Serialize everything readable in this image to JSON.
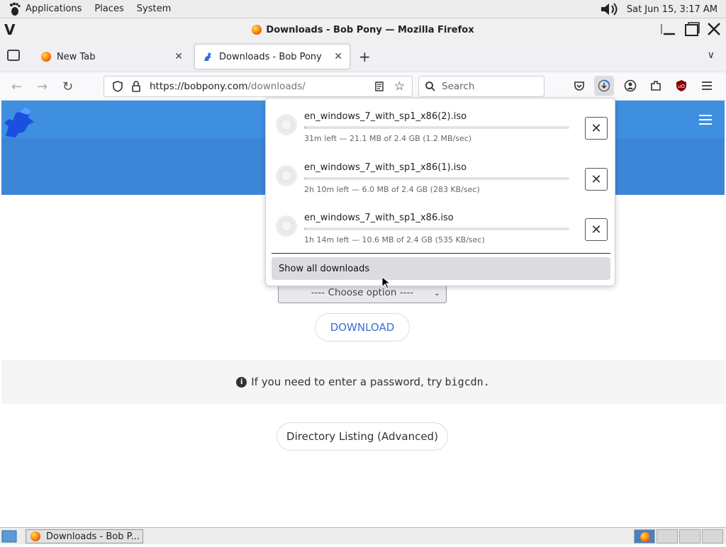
{
  "panel": {
    "menus": [
      "Applications",
      "Places",
      "System"
    ],
    "clock": "Sat Jun 15,  3:17 AM"
  },
  "window": {
    "title": "Downloads - Bob Pony — Mozilla Firefox"
  },
  "tabs": [
    {
      "label": "New Tab",
      "active": false
    },
    {
      "label": "Downloads - Bob Pony",
      "active": true
    }
  ],
  "navbar": {
    "url_host": "https://bobpony.com",
    "url_path": "/downloads/",
    "search_placeholder": "Search"
  },
  "page": {
    "select_value": "---- Choose option ----",
    "download_label": "DOWNLOAD",
    "password_text": "If you need to enter a password, try",
    "password_value": "bigcdn",
    "password_end": ".",
    "directory_label": "Directory Listing (Advanced)"
  },
  "downloads_panel": {
    "items": [
      {
        "name": "en_windows_7_with_sp1_x86(2).iso",
        "status": "31m left — 21.1 MB of 2.4 GB (1.2 MB/sec)",
        "progress": 0.009
      },
      {
        "name": "en_windows_7_with_sp1_x86(1).iso",
        "status": "2h 10m left — 6.0 MB of 2.4 GB (283 KB/sec)",
        "progress": 0.0025
      },
      {
        "name": "en_windows_7_with_sp1_x86.iso",
        "status": "1h 14m left — 10.6 MB of 2.4 GB (535 KB/sec)",
        "progress": 0.0044
      }
    ],
    "show_all_label": "Show all downloads"
  },
  "taskbar": {
    "task_label": "Downloads - Bob P..."
  }
}
